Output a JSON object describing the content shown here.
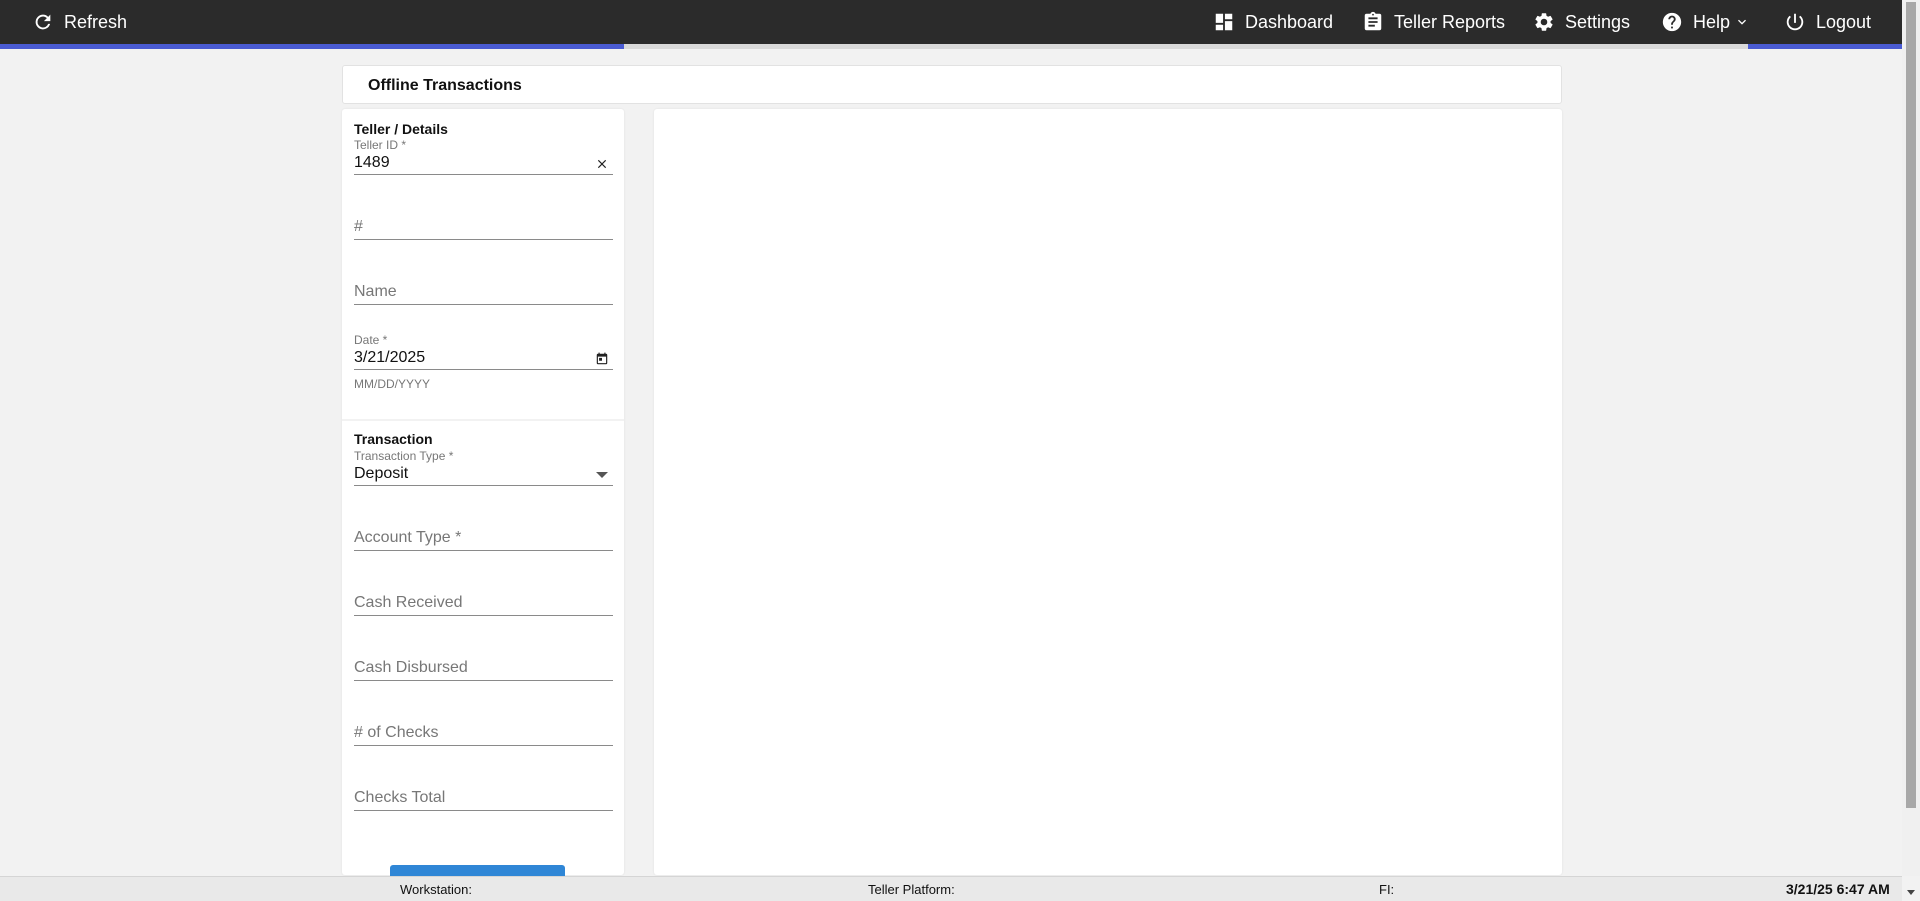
{
  "topbar": {
    "refresh_label": "Refresh",
    "dashboard_label": "Dashboard",
    "teller_reports_label": "Teller Reports",
    "settings_label": "Settings",
    "help_label": "Help",
    "logout_label": "Logout"
  },
  "header": {
    "title": "Offline Transactions"
  },
  "teller_details": {
    "section_title": "Teller / Details",
    "teller_id": {
      "label": "Teller ID *",
      "value": "1489"
    },
    "number": {
      "placeholder": "#"
    },
    "name": {
      "placeholder": "Name"
    },
    "date": {
      "label": "Date *",
      "value": "3/21/2025",
      "hint": "MM/DD/YYYY"
    }
  },
  "transaction": {
    "section_title": "Transaction",
    "transaction_type": {
      "label": "Transaction Type *",
      "value": "Deposit"
    },
    "account_type": {
      "placeholder": "Account Type *"
    },
    "cash_received": {
      "placeholder": "Cash Received"
    },
    "cash_disbursed": {
      "placeholder": "Cash Disbursed"
    },
    "num_checks": {
      "placeholder": "# of Checks"
    },
    "checks_total": {
      "placeholder": "Checks Total"
    }
  },
  "statusbar": {
    "workstation_label": "Workstation:",
    "teller_platform_label": "Teller Platform:",
    "fi_label": "FI:",
    "timestamp": "3/21/25 6:47 AM"
  },
  "colors": {
    "topbar_bg": "#2b2b2b",
    "accent": "#4a5bd3",
    "primary_button": "#2f86d6"
  },
  "icons": {
    "refresh": "refresh-icon",
    "dashboard": "dashboard-icon",
    "reports": "clipboard-icon",
    "settings": "gear-icon",
    "help": "help-circle-icon",
    "logout": "power-icon",
    "clear": "close-icon",
    "calendar": "calendar-icon",
    "dropdown": "caret-down-icon"
  }
}
